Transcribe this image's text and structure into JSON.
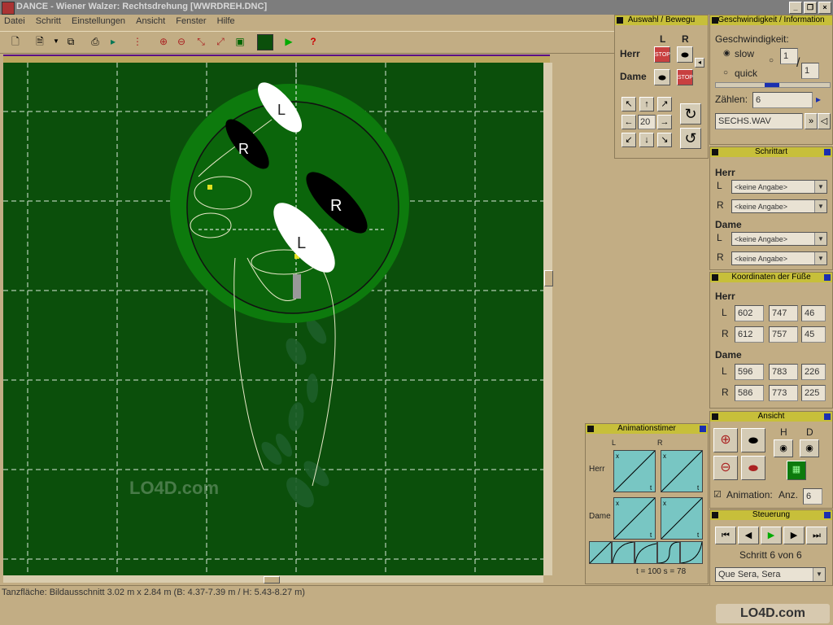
{
  "window": {
    "title": "DANCE - Wiener Walzer: Rechtsdrehung [WWRDREH.DNC]"
  },
  "menu": [
    "Datei",
    "Schritt",
    "Einstellungen",
    "Ansicht",
    "Fenster",
    "Hilfe"
  ],
  "auswahl": {
    "header": "Auswahl / Bewegu",
    "col_l": "L",
    "col_r": "R",
    "herr": "Herr",
    "dame": "Dame",
    "step_value": "20"
  },
  "speed": {
    "header": "Geschwindigkeit / Information",
    "label": "Geschwindigkeit:",
    "slow": "slow",
    "quick": "quick",
    "frac_top": "1",
    "frac_bottom": "1",
    "zahlen_label": "Zählen:",
    "zahlen_value": "6",
    "sound_value": "SECHS.WAV"
  },
  "schrittart": {
    "header": "Schrittart",
    "herr": "Herr",
    "dame": "Dame",
    "l": "L",
    "r": "R",
    "herr_l": "<keine Angabe>",
    "herr_r": "<keine Angabe>",
    "dame_l": "<keine Angabe>",
    "dame_r": "<keine Angabe>"
  },
  "koord": {
    "header": "Koordinaten der Füße",
    "herr": "Herr",
    "dame": "Dame",
    "l": "L",
    "r": "R",
    "herr_l": [
      "602",
      "747",
      "46"
    ],
    "herr_r": [
      "612",
      "757",
      "45"
    ],
    "dame_l": [
      "596",
      "783",
      "226"
    ],
    "dame_r": [
      "586",
      "773",
      "225"
    ]
  },
  "ansicht": {
    "header": "Ansicht",
    "h": "H",
    "d": "D",
    "animation_label": "Animation:",
    "anz_label": "Anz.",
    "anz_value": "6"
  },
  "animationstimer": {
    "header": "Animationstimer",
    "l": "L",
    "r": "R",
    "herr": "Herr",
    "dame": "Dame",
    "x": "x",
    "t": "t",
    "info": "t = 100  s =   78"
  },
  "steuerung": {
    "header": "Steuerung",
    "step_text": "Schritt 6 von 6",
    "song": "Que Sera, Sera"
  },
  "foot_labels": {
    "l": "L",
    "r": "R"
  },
  "status": {
    "text": "Tanzfläche: Bildausschnitt 3.02 m x 2.84 m (B: 4.37-7.39 m / H: 5.43-8.27 m)"
  },
  "watermark": {
    "text": "LO4D.com"
  },
  "colors": {
    "floor": "#0b4f0b",
    "panel": "#c2ad84",
    "header": "#c7bf3a",
    "timer": "#78c6c3"
  }
}
